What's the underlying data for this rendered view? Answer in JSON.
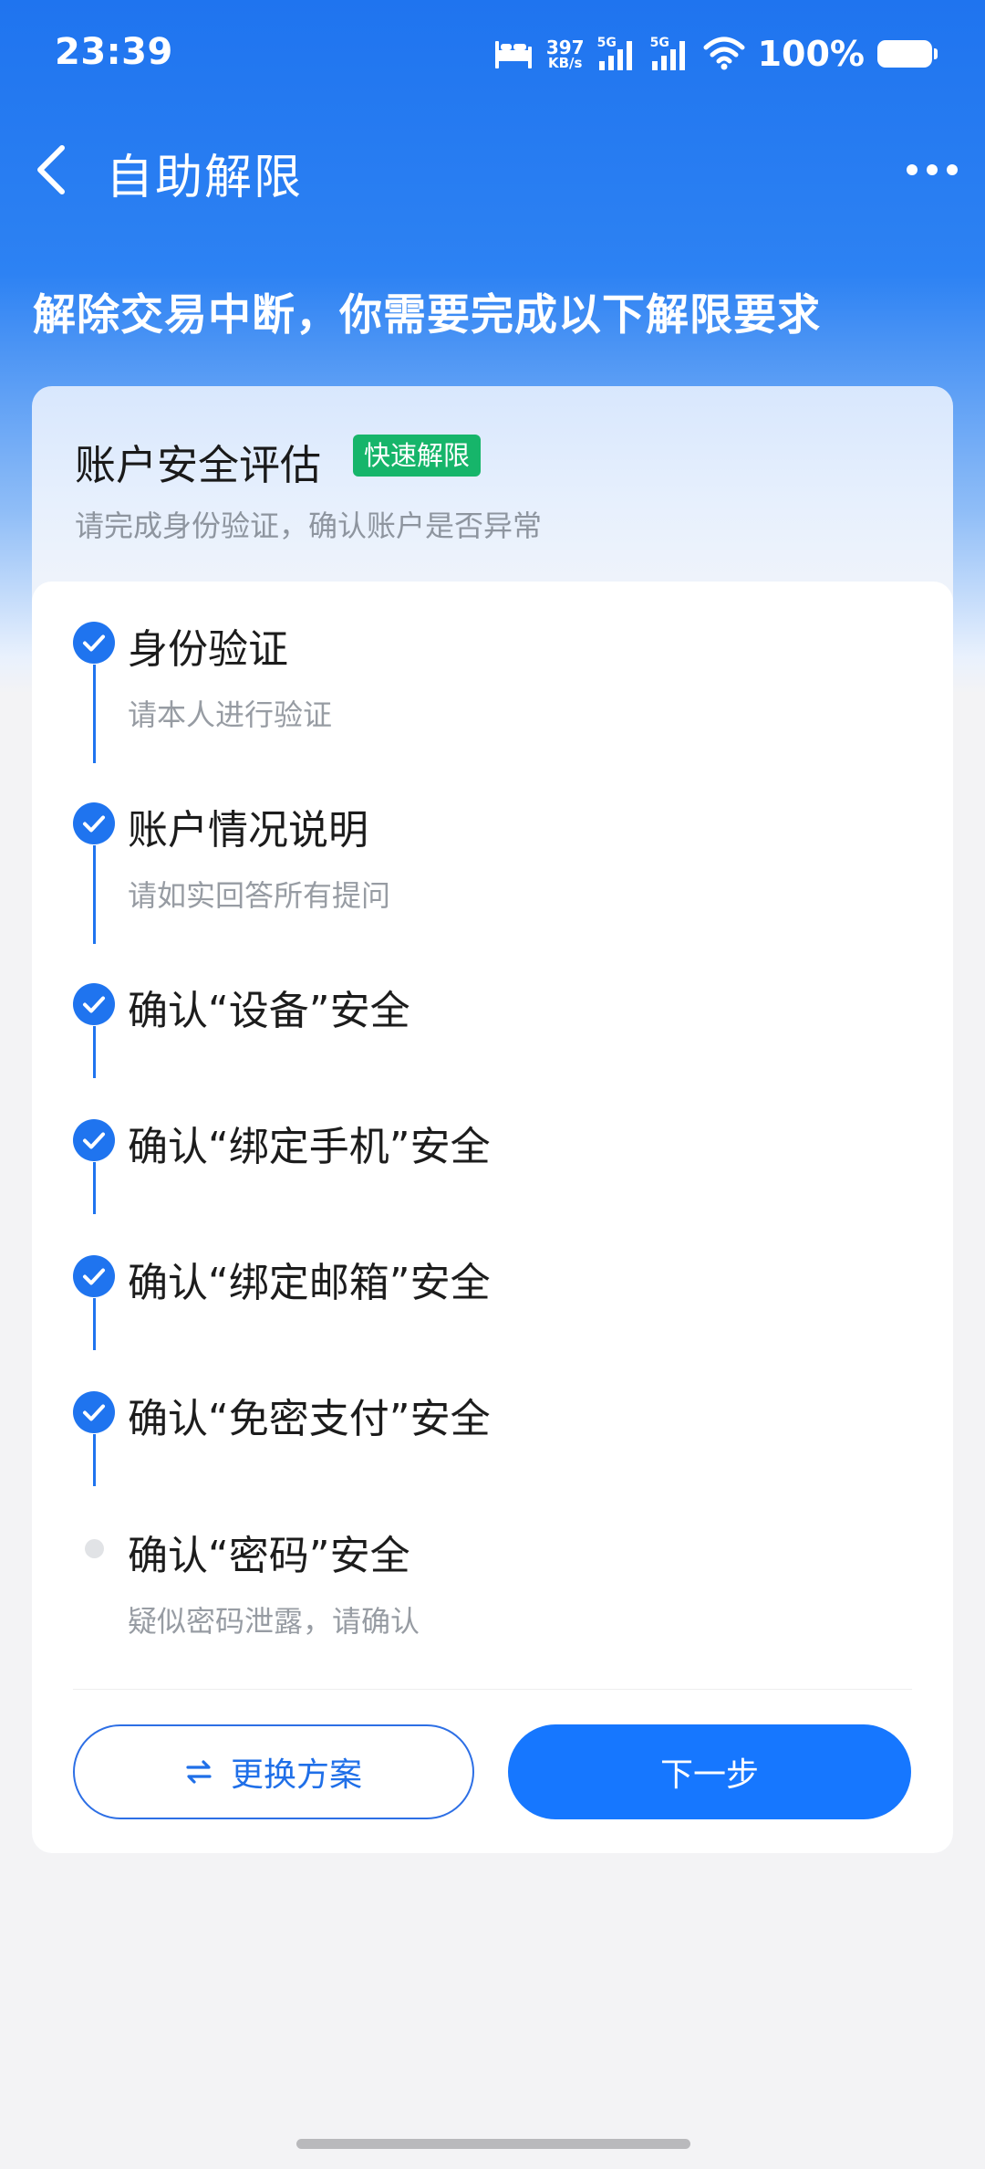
{
  "status_bar": {
    "time": "23:39",
    "net_speed_value": "397",
    "net_speed_unit": "KB/s",
    "sim1_tag": "5G",
    "sim2_tag": "5G",
    "battery_percent": "100%",
    "icons": [
      "bed-icon",
      "signal-icon",
      "wifi-icon",
      "battery-icon"
    ]
  },
  "nav": {
    "title": "自助解限",
    "back_icon": "chevron-left-icon",
    "more_icon": "more-dots-icon"
  },
  "headline": "解除交易中断，你需要完成以下解限要求",
  "card": {
    "title": "账户安全评估",
    "badge": "快速解限",
    "subtitle": "请完成身份验证，确认账户是否异常",
    "steps": [
      {
        "title": "身份验证",
        "desc": "请本人进行验证",
        "done": true
      },
      {
        "title": "账户情况说明",
        "desc": "请如实回答所有提问",
        "done": true
      },
      {
        "title": "确认“设备”安全",
        "done": true
      },
      {
        "title": "确认“绑定手机”安全",
        "done": true
      },
      {
        "title": "确认“绑定邮箱”安全",
        "done": true
      },
      {
        "title": "确认“免密支付”安全",
        "done": true
      },
      {
        "title": "确认“密码”安全",
        "desc": "疑似密码泄露，请确认",
        "done": false
      }
    ],
    "switch_button": "更换方案",
    "next_button": "下一步"
  },
  "colors": {
    "primary": "#1677ff",
    "header": "#1f74ef",
    "badge": "#16b56a"
  }
}
